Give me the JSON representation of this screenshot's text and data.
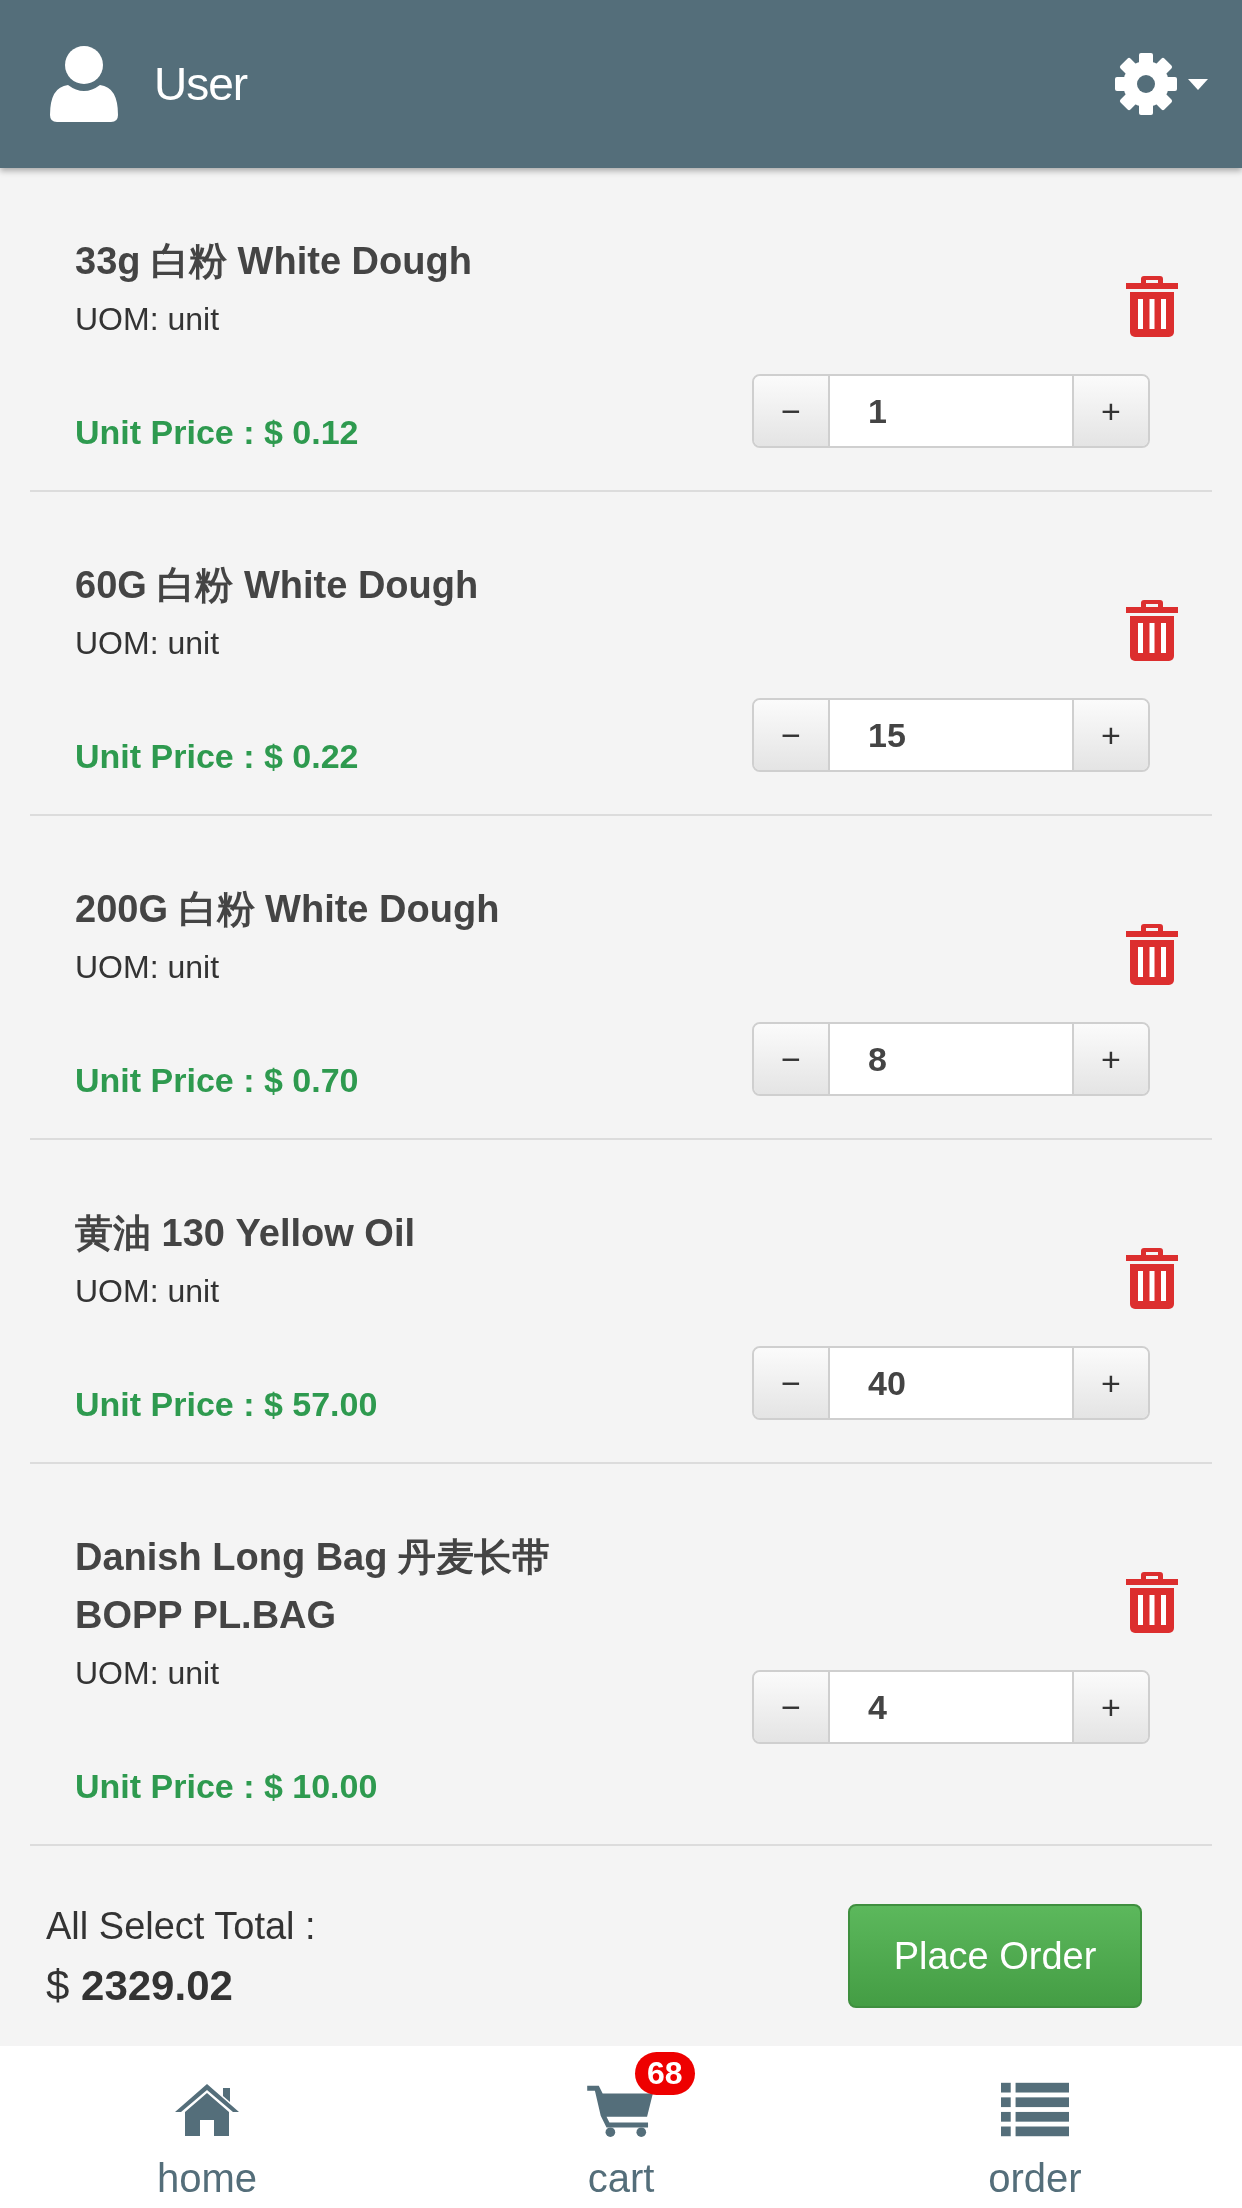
{
  "header": {
    "title": "User"
  },
  "cart_items": [
    {
      "name": "33g 白粉 White Dough",
      "uom": "UOM: unit",
      "unit_price": "Unit Price : $ 0.12",
      "quantity": "1",
      "minus": "−",
      "plus": "+"
    },
    {
      "name": "60G 白粉 White Dough",
      "uom": "UOM: unit",
      "unit_price": "Unit Price : $ 0.22",
      "quantity": "15",
      "minus": "−",
      "plus": "+"
    },
    {
      "name": "200G 白粉 White Dough",
      "uom": "UOM: unit",
      "unit_price": "Unit Price : $ 0.70",
      "quantity": "8",
      "minus": "−",
      "plus": "+"
    },
    {
      "name": "黄油 130 Yellow Oil",
      "uom": "UOM: unit",
      "unit_price": "Unit Price : $ 57.00",
      "quantity": "40",
      "minus": "−",
      "plus": "+"
    },
    {
      "name": "Danish Long Bag 丹麦长带 BOPP PL.BAG",
      "uom": "UOM: unit",
      "unit_price": "Unit Price : $ 10.00",
      "quantity": "4",
      "minus": "−",
      "plus": "+"
    }
  ],
  "total": {
    "label": "All Select Total :",
    "amount": "$ **2329.02**"
  },
  "place_order_button": "Place Order",
  "bottom_nav": [
    {
      "kind": "home",
      "label": "home"
    },
    {
      "kind": "cart",
      "label": "cart",
      "badge": "68"
    },
    {
      "kind": "order",
      "label": "order"
    }
  ]
}
